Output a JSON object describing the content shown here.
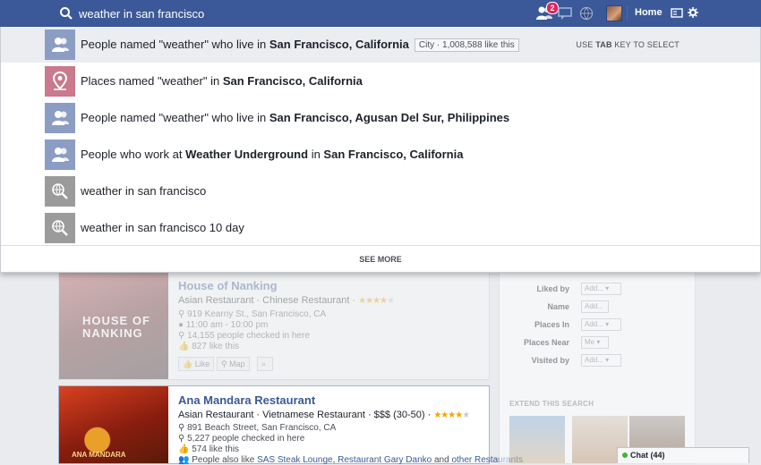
{
  "search": {
    "query": "weather in san francisco"
  },
  "topbar": {
    "home_label": "Home",
    "notification_count": "2"
  },
  "dropdown": {
    "tab_hint_prefix": "USE ",
    "tab_hint_key": "TAB",
    "tab_hint_suffix": " KEY TO SELECT",
    "see_more": "SEE MORE",
    "rows": [
      {
        "prefix": "People named \"weather\" who live in ",
        "bold": "San Francisco, California",
        "pill": "City · 1,008,588 like this"
      },
      {
        "prefix": "Places named \"weather\" in ",
        "bold": "San Francisco, California"
      },
      {
        "prefix": "People named \"weather\" who live in ",
        "bold": "San Francisco, Agusan Del Sur, Philippines"
      },
      {
        "prefix": "People who work at ",
        "bold": "Weather Underground",
        "mid": " in ",
        "bold2": "San Francisco, California"
      },
      {
        "text": "weather in san francisco"
      },
      {
        "text": "weather in san francisco 10 day"
      }
    ]
  },
  "results": [
    {
      "title": "House of Nanking",
      "categories": "Asian Restaurant · Chinese Restaurant · ",
      "address": "919 Kearny St., San Francisco, CA",
      "hours": "11:00 am - 10:00 pm",
      "checkins": "14,155 people checked in here",
      "likes": "827 like this",
      "like_btn": "Like",
      "map_btn": "Map",
      "thumb_text": "HOUSE OF NANKING"
    },
    {
      "title": "Ana Mandara Restaurant",
      "categories": "Asian Restaurant · Vietnamese Restaurant · $$$ (30-50) · ",
      "address": "891 Beach Street, San Francisco, CA",
      "checkins": "5,227 people checked in here",
      "likes": "574 like this",
      "also_prefix": "People also like ",
      "also_1": "SAS Steak Lounge",
      "also_sep": ", ",
      "also_2": "Restaurant Gary Danko",
      "also_and": " and ",
      "also_3": "other Restaurants",
      "thumb_text": "ANA MANDARA"
    }
  ],
  "filters": {
    "rows": [
      {
        "label": "Liked by",
        "value": "Add..."
      },
      {
        "label": "Name",
        "value": "Add..."
      },
      {
        "label": "Places In",
        "value": "Add..."
      },
      {
        "label": "Places Near",
        "value": "Me"
      },
      {
        "label": "Visited by",
        "value": "Add..."
      }
    ],
    "extend_title": "EXTEND THIS SEARCH"
  },
  "chat": {
    "label": "Chat",
    "count": "(44)"
  }
}
